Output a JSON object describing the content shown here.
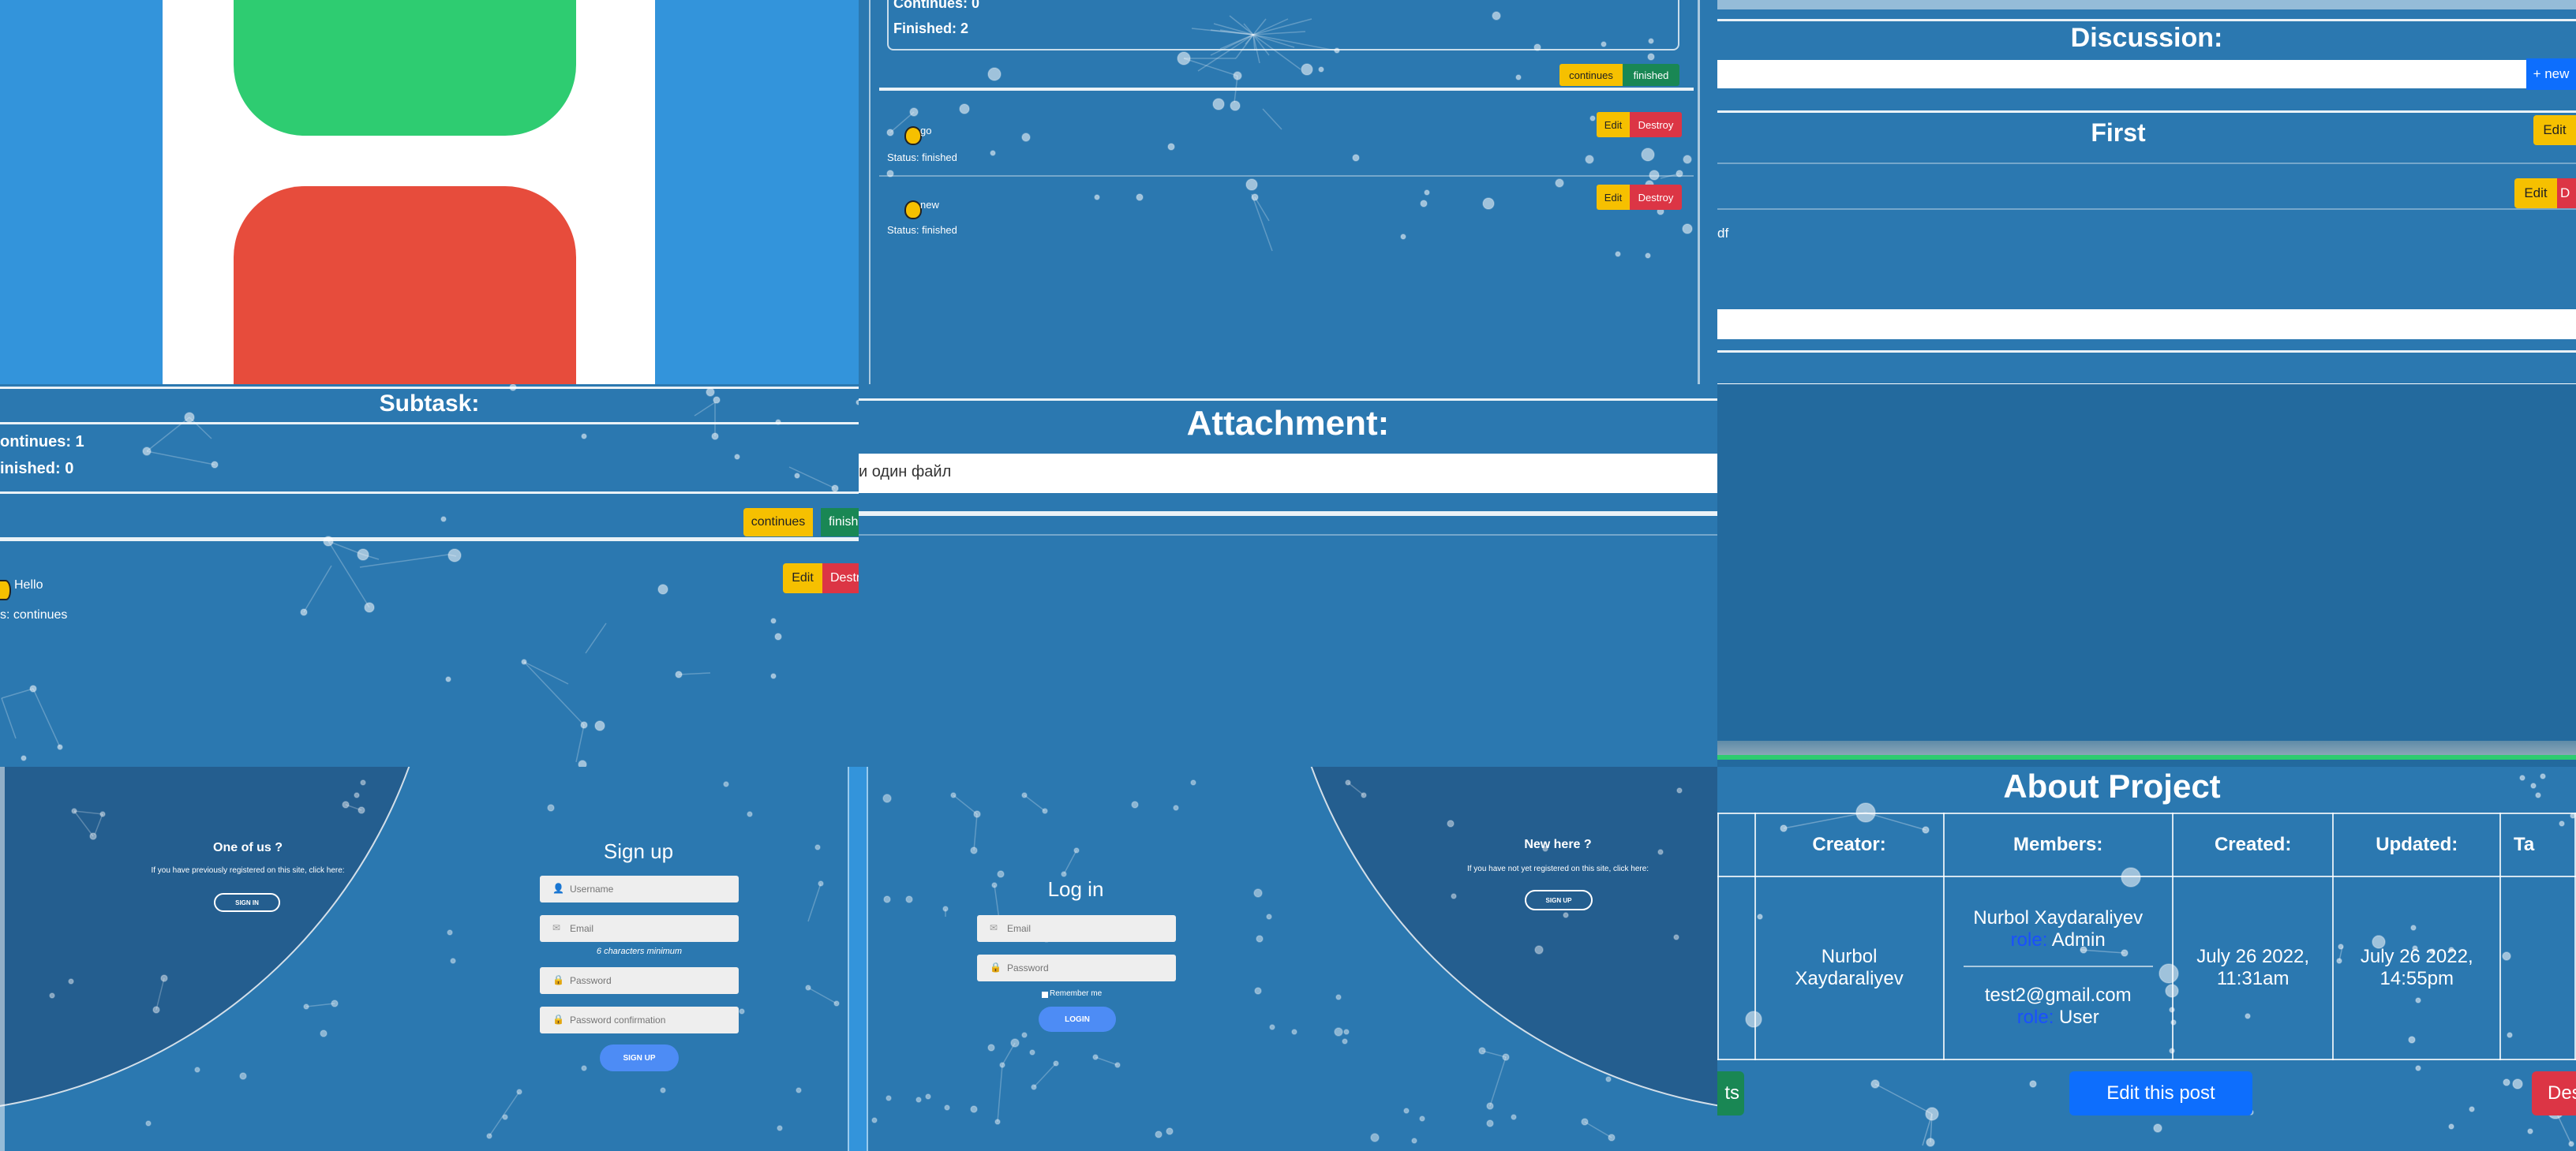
{
  "colors": {
    "bg": "#2b78b0",
    "warning": "#f6c000",
    "danger": "#dc3545",
    "success": "#198754",
    "primary": "#0d6efd",
    "green": "#2ecc71",
    "red": "#e74c3c",
    "white": "#ffffff",
    "dark_circle": "#245e8f"
  },
  "logo_panel": {
    "icon": "app-logo-icon"
  },
  "task_panel": {
    "summary": {
      "continues": "Continues: 0",
      "finished": "Finished: 2"
    },
    "filter": {
      "continues": "continues",
      "finished": "finished"
    },
    "subtasks": [
      {
        "title": "go",
        "status": "Status: finished",
        "edit": "Edit",
        "destroy": "Destroy"
      },
      {
        "title": "new",
        "status": "Status: finished",
        "edit": "Edit",
        "destroy": "Destroy"
      }
    ]
  },
  "discussion_panel": {
    "title": "Discussion:",
    "new_button": "+ new",
    "post_title": "First",
    "post_edit": "Edit",
    "comment_edit": "Edit",
    "comment_destroy": "D",
    "comment_text": "df"
  },
  "subtask_panel": {
    "title": "Subtask:",
    "continues": "ontinues: 1",
    "finished": "inished: 0",
    "filter": {
      "continues": "continues",
      "finished": "finish"
    },
    "item": {
      "title": "Hello",
      "status": "s: continues",
      "edit": "Edit",
      "destroy": "Destr"
    }
  },
  "attachment_panel": {
    "title": "Attachment:",
    "file_text": "и один файл"
  },
  "signup_panel": {
    "side_title": "One of us ?",
    "side_text": "If you have previously registered on this site, click here:",
    "side_button": "SIGN IN",
    "form_title": "Sign up",
    "username": "Username",
    "email": "Email",
    "hint": "6 characters minimum",
    "password": "Password",
    "password_confirmation": "Password confirmation",
    "submit": "SIGN UP"
  },
  "login_panel": {
    "form_title": "Log in",
    "email": "Email",
    "password": "Password",
    "remember": "Remember me",
    "submit": "LOGIN",
    "side_title": "New here ?",
    "side_text": "If you have not yet registered on this site, click here:",
    "side_button": "SIGN UP"
  },
  "about_panel": {
    "title": "About Project",
    "headers": [
      "Creator:",
      "Members:",
      "Created:",
      "Updated:",
      "Ta"
    ],
    "creator": "Nurbol Xaydaraliyev",
    "member1_name": "Nurbol Xaydaraliyev",
    "role_label": "role:",
    "member1_role": " Admin",
    "member2_name": "test2@gmail.com",
    "member2_role": " User",
    "created_date": "July 26 2022,",
    "created_time": "11:31am",
    "updated_date": "July 26 2022,",
    "updated_time": "14:55pm",
    "left_button": "ts",
    "edit_button": "Edit this post",
    "right_button": "Des"
  }
}
